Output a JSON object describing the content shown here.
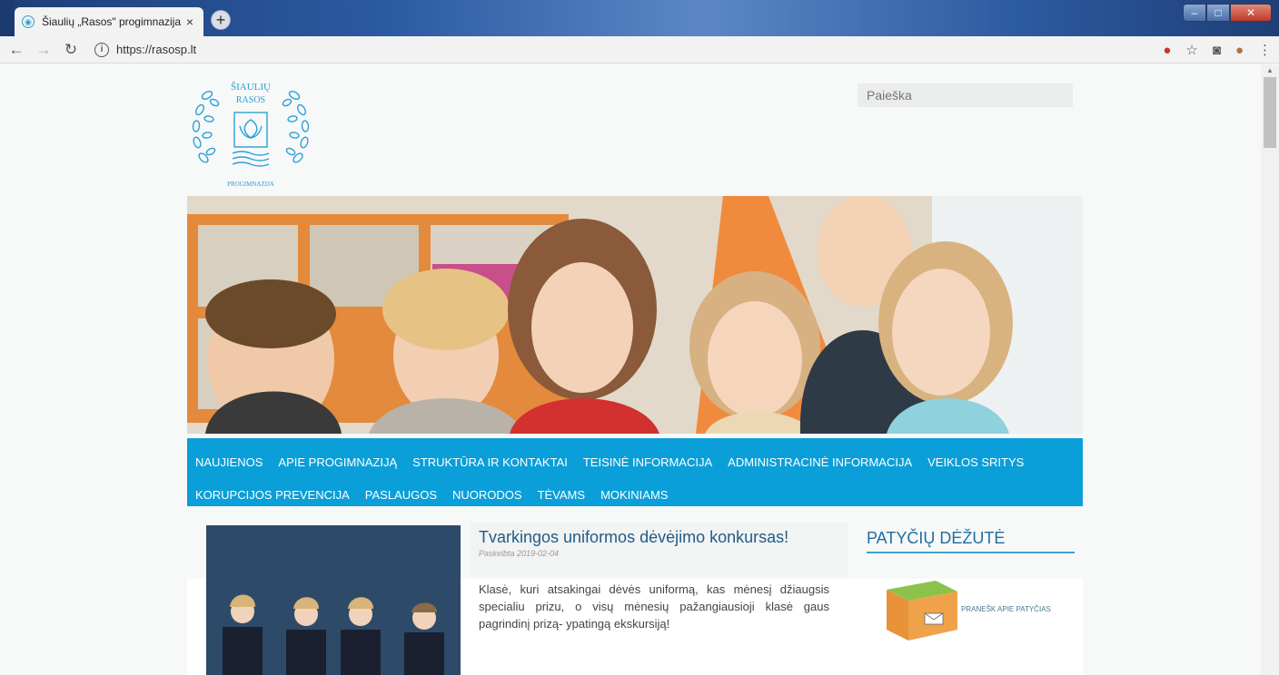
{
  "browser": {
    "tab_title": "Šiaulių „Rasos\" progimnazija Šiau",
    "tab_close": "×",
    "new_tab": "+",
    "url": "https://rasosp.lt",
    "window_controls": {
      "minimize": "–",
      "maximize": "□",
      "close": "✕"
    }
  },
  "header": {
    "logo_text_top": "ŠIAULIŲ",
    "logo_text_mid": "RASOS",
    "logo_text_bottom": "PROGIMNAZIJA",
    "search_placeholder": "Paieška"
  },
  "nav": {
    "row1": [
      "NAUJIENOS",
      "APIE PROGIMNAZIJĄ",
      "STRUKTŪRA IR KONTAKTAI",
      "TEISINĖ INFORMACIJA",
      "ADMINISTRACINĖ INFORMACIJA",
      "VEIKLOS SRITYS"
    ],
    "row2": [
      "KORUPCIJOS PREVENCIJA",
      "PASLAUGOS",
      "NUORODOS",
      "TĖVAMS",
      "MOKINIAMS"
    ]
  },
  "post": {
    "title": "Tvarkingos uniformos dėvėjimo konkursas!",
    "date": "Paskelbta 2019-02-04",
    "text": "Klasė, kuri atsakingai dėvės uniformą, kas mėnesį džiaugsis specialiu prizu, o visų mėnesių pažangiausioji klasė gaus pagrindinį prizą- ypatingą ekskursiją!"
  },
  "sidebar": {
    "title": "PATYČIŲ DĖŽUTĖ",
    "box_label": "PRANEŠK APIE PATYČIAS"
  },
  "colors": {
    "nav": "#0a9fd8",
    "title": "#1f5c8a",
    "logo": "#2aa0d6"
  }
}
